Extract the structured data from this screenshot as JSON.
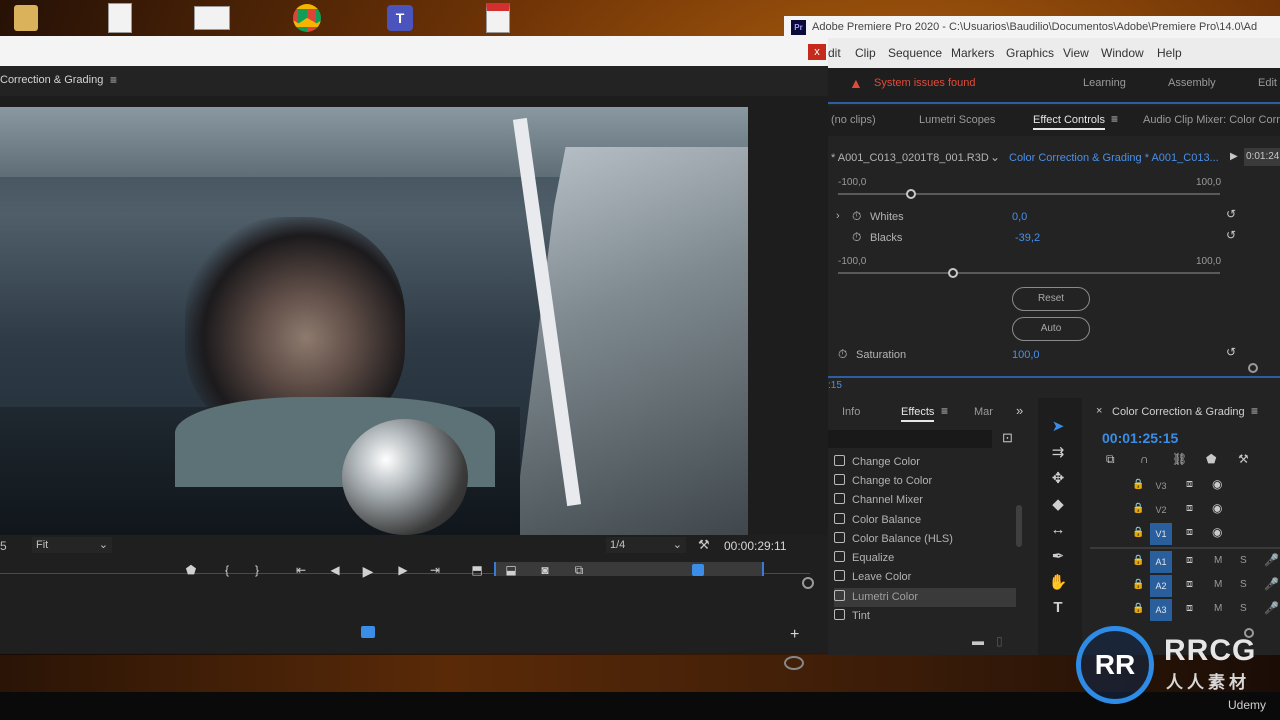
{
  "desktop": {
    "icons": [
      "user-folder-icon",
      "document-icon",
      "file-icon",
      "chrome-icon",
      "teams-icon",
      "pdf-icon"
    ]
  },
  "program_window": {
    "close_label": "x",
    "panel_title": "Correction & Grading",
    "menu_glyph": "≡",
    "fit_label": "Fit",
    "resolution": "1/4",
    "timecode_right": "00:00:29:11",
    "timecode_left": "5"
  },
  "app": {
    "title": "Adobe Premiere Pro 2020 - C:\\Usuarios\\Baudilio\\Documentos\\Adobe\\Premiere Pro\\14.0\\Ad",
    "menu": [
      "dit",
      "Clip",
      "Sequence",
      "Markers",
      "Graphics",
      "View",
      "Window",
      "Help"
    ],
    "issues": "System issues found",
    "workspaces": [
      "Learning",
      "Assembly",
      "Edit"
    ],
    "tabs": [
      "(no clips)",
      "Lumetri Scopes",
      "Effect Controls",
      "Audio Clip Mixer: Color Corre"
    ],
    "active_tab": "Effect Controls"
  },
  "effect_controls": {
    "source_clip": "* A001_C013_0201T8_001.R3D",
    "sequence_clip": "Color Correction & Grading * A001_C013...",
    "timecode": "0:01:24",
    "range_min": "-100,0",
    "range_max": "100,0",
    "whites_label": "Whites",
    "whites_value": "0,0",
    "blacks_label": "Blacks",
    "blacks_value": "-39,2",
    "blacks_slider": 0.3,
    "whites_slider": 0.19,
    "reset_label": "Reset",
    "auto_label": "Auto",
    "saturation_label": "Saturation",
    "saturation_value": "100,0",
    "timebar_label": ":15"
  },
  "effects_panel": {
    "tabs": [
      "Info",
      "Effects",
      "Mar"
    ],
    "active_tab": "Effects",
    "more": "»",
    "items": [
      "Change Color",
      "Change to Color",
      "Channel Mixer",
      "Color Balance",
      "Color Balance (HLS)",
      "Equalize",
      "Leave Color",
      "Lumetri Color",
      "Tint"
    ],
    "highlighted": "Lumetri Color"
  },
  "timeline": {
    "title": "Color Correction & Grading",
    "timecode": "00:01:25:15",
    "video_tracks": [
      "V3",
      "V2",
      "V1"
    ],
    "audio_tracks": [
      "A1",
      "A2",
      "A3"
    ],
    "m_label": "M",
    "s_label": "S"
  },
  "watermark": {
    "logo": "RR",
    "brand": "RRCG",
    "sub": "人人素材",
    "udemy": "Udemy"
  }
}
